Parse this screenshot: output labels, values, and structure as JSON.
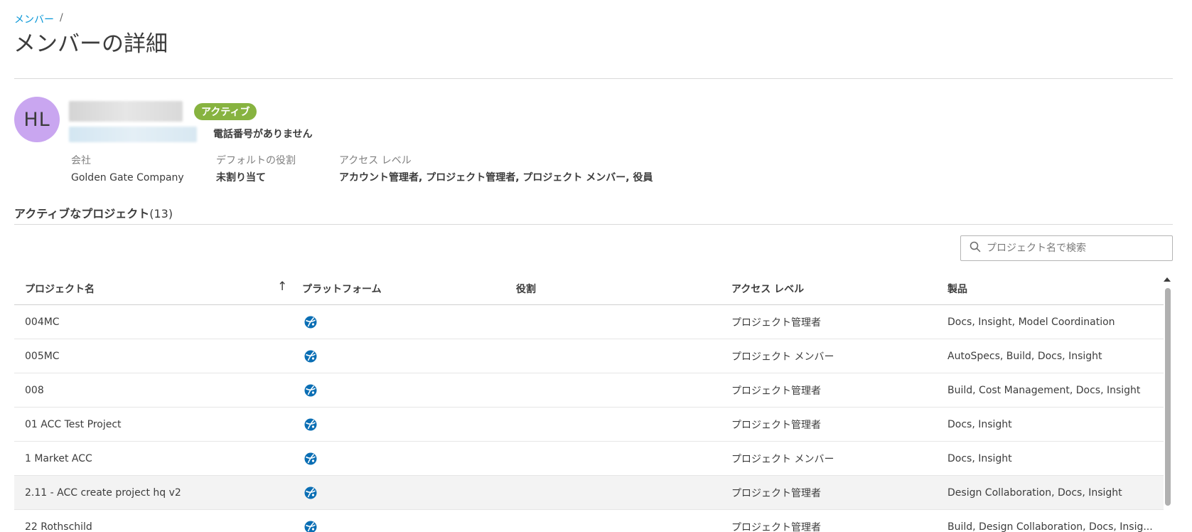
{
  "breadcrumb": {
    "parent": "メンバー",
    "separator": "/"
  },
  "page": {
    "title": "メンバーの詳細"
  },
  "member": {
    "initials": "HL",
    "status": "アクティブ",
    "phone": "電話番号がありません",
    "company_label": "会社",
    "company": "Golden Gate Company",
    "role_label": "デフォルトの役割",
    "role": "未割り当て",
    "access_label": "アクセス レベル",
    "access": "アカウント管理者, プロジェクト管理者, プロジェクト メンバー, 役員"
  },
  "projects": {
    "title": "アクティブなプロジェクト",
    "count": "(13)",
    "search_placeholder": "プロジェクト名で検索",
    "columns": [
      "プロジェクト名",
      "プラットフォーム",
      "役割",
      "アクセス レベル",
      "製品"
    ],
    "rows": [
      {
        "name": "004MC",
        "role": "",
        "access": "プロジェクト管理者",
        "products": "Docs, Insight, Model Coordination"
      },
      {
        "name": "005MC",
        "role": "",
        "access": "プロジェクト メンバー",
        "products": "AutoSpecs, Build, Docs, Insight"
      },
      {
        "name": "008",
        "role": "",
        "access": "プロジェクト管理者",
        "products": "Build, Cost Management, Docs, Insight"
      },
      {
        "name": "01 ACC Test Project",
        "role": "",
        "access": "プロジェクト管理者",
        "products": "Docs, Insight"
      },
      {
        "name": "1 Market ACC",
        "role": "",
        "access": "プロジェクト メンバー",
        "products": "Docs, Insight"
      },
      {
        "name": "2.11 - ACC create project hq v2",
        "role": "",
        "access": "プロジェクト管理者",
        "products": "Design Collaboration, Docs, Insight"
      },
      {
        "name": "22 Rothschild",
        "role": "",
        "access": "プロジェクト管理者",
        "products": "Build, Design Collaboration, Docs, Insig..."
      }
    ]
  },
  "colors": {
    "accent": "#0696d7",
    "active_badge": "#87b340",
    "avatar": "#c9a6f0",
    "platform_icon": "#0a6eb4"
  },
  "icons": {
    "search": "search-icon",
    "sort": "sort-ascending-icon",
    "platform": "platform-globe-icon"
  }
}
